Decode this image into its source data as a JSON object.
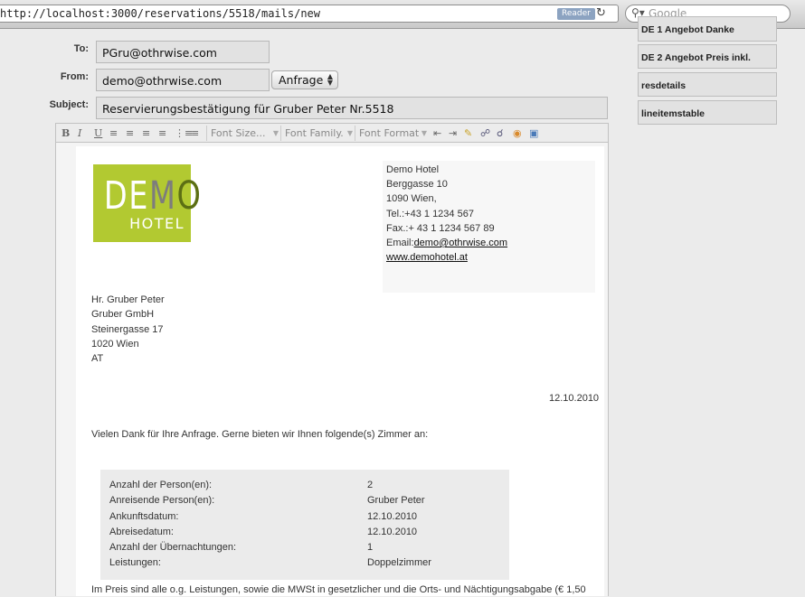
{
  "browser": {
    "url": "http://localhost:3000/reservations/5518/mails/new",
    "reader_label": "Reader",
    "search_placeholder": "Google"
  },
  "form": {
    "to_label": "To:",
    "to_value": "PGru@othrwise.com",
    "from_label": "From:",
    "from_value": "demo@othrwise.com",
    "from_select": "Anfrage",
    "subject_label": "Subject:",
    "subject_value": "Reservierungsbestätigung für Gruber Peter Nr.5518"
  },
  "toolbar": {
    "font_size": "Font Size...",
    "font_family": "Font Family.",
    "font_format": "Font Format"
  },
  "letter": {
    "logo_text": "DEMO",
    "logo_sub": "HOTEL",
    "hotel_name": "Demo Hotel",
    "hotel_street": "Berggasse 10",
    "hotel_city": "1090 Wien,",
    "hotel_tel": "Tel.:+43 1 1234 567",
    "hotel_fax": "Fax.:+ 43 1 1234 567 89",
    "hotel_email_label": "Email:",
    "hotel_email": "demo@othrwise.com",
    "hotel_web": "www.demohotel.at",
    "recipient": [
      "Hr. Gruber Peter",
      "Gruber GmbH",
      "Steinergasse 17",
      "1020 Wien",
      "AT"
    ],
    "date": "12.10.2010",
    "greeting": "Vielen Dank für Ihre Anfrage. Gerne bieten wir Ihnen folgende(s) Zimmer an:",
    "table": [
      {
        "label": "Anzahl der Person(en):",
        "value": "2"
      },
      {
        "label": "Anreisende Person(en):",
        "value": "Gruber Peter"
      },
      {
        "label": "Ankunftsdatum:",
        "value": "12.10.2010"
      },
      {
        "label": "Abreisedatum:",
        "value": "12.10.2010"
      },
      {
        "label": "Anzahl der Übernachtungen:",
        "value": "1"
      },
      {
        "label": "Leistungen:",
        "value": "Doppelzimmer"
      }
    ],
    "footer_line": "Im Preis sind alle o.g. Leistungen, sowie die MWSt in gesetzlicher und die Orts- und Nächtigungsabgabe (€ 1,50"
  },
  "templates": [
    "DE 1 Angebot Danke",
    "DE 2 Angebot Preis inkl.",
    "resdetails",
    "lineitemstable"
  ],
  "colors": {
    "logo_green": "#b2c931",
    "logo_dark": "#5c6f14",
    "logo_mid": "#7d7d7d"
  }
}
